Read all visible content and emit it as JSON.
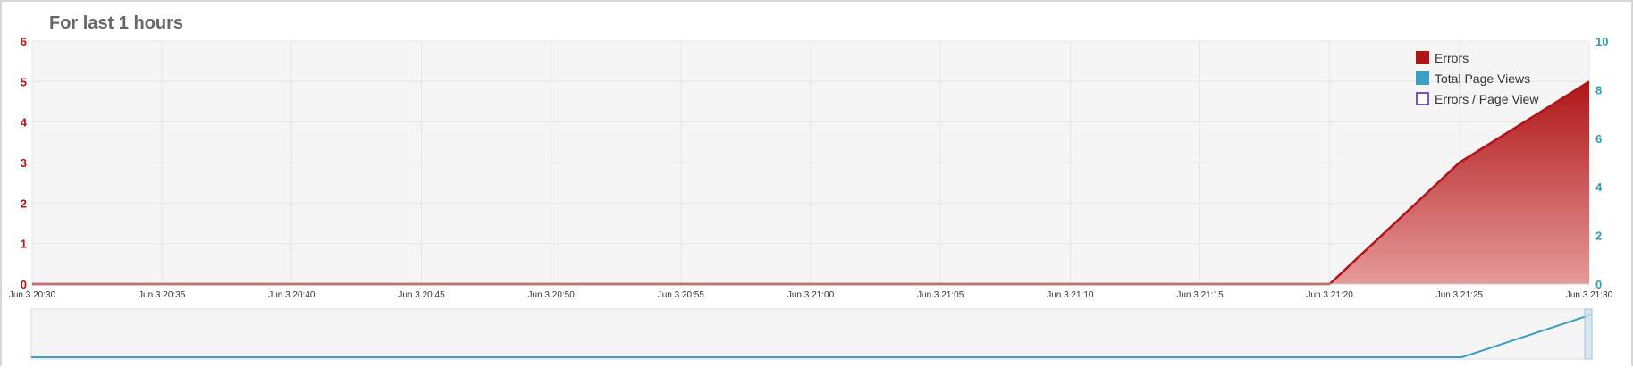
{
  "header": {
    "title": "For last 1 hours"
  },
  "colors": {
    "errors": "#b01518",
    "errors_fill_top": "#b01518",
    "errors_fill_bottom": "#e59a9a",
    "page_views": "#3a9fc4",
    "errors_per_page_view": "#7b52c9",
    "left_axis": "#b01518",
    "right_axis": "#2a9fc0",
    "plot_bg": "#f5f5f5"
  },
  "chart_data": {
    "type": "area",
    "title": "For last 1 hours",
    "x": [
      "Jun 3 20:30",
      "Jun 3 20:35",
      "Jun 3 20:40",
      "Jun 3 20:45",
      "Jun 3 20:50",
      "Jun 3 20:55",
      "Jun 3 21:00",
      "Jun 3 21:05",
      "Jun 3 21:10",
      "Jun 3 21:15",
      "Jun 3 21:20",
      "Jun 3 21:25",
      "Jun 3 21:30"
    ],
    "x_tick_labels": [
      "Jun 3 20:30",
      "Jun 3 20:35",
      "Jun 3 20:40",
      "Jun 3 20:45",
      "Jun 3 20:50",
      "Jun 3 20:55",
      "Jun 3 21:00",
      "Jun 3 21:05",
      "Jun 3 21:10",
      "Jun 3 21:15",
      "Jun 3 21:20",
      "Jun 3 21:25",
      "Jun 3 21:30"
    ],
    "series": [
      {
        "name": "Errors",
        "axis": "left",
        "values": [
          0,
          0,
          0,
          0,
          0,
          0,
          0,
          0,
          0,
          0,
          0,
          3,
          5
        ]
      },
      {
        "name": "Total Page Views",
        "axis": "right",
        "values": []
      },
      {
        "name": "Errors / Page View",
        "axis": "right",
        "values": []
      }
    ],
    "ylim_left": [
      0,
      6
    ],
    "yticks_left": [
      0,
      1,
      2,
      3,
      4,
      5,
      6
    ],
    "ylim_right": [
      0,
      10
    ],
    "yticks_right": [
      0,
      2,
      4,
      6,
      8,
      10
    ],
    "grid": true,
    "legend_position": "top-right",
    "navigator": {
      "series": "Errors",
      "values": [
        0,
        0,
        0,
        0,
        0,
        0,
        0,
        0,
        0,
        0,
        0,
        0,
        5
      ]
    }
  }
}
